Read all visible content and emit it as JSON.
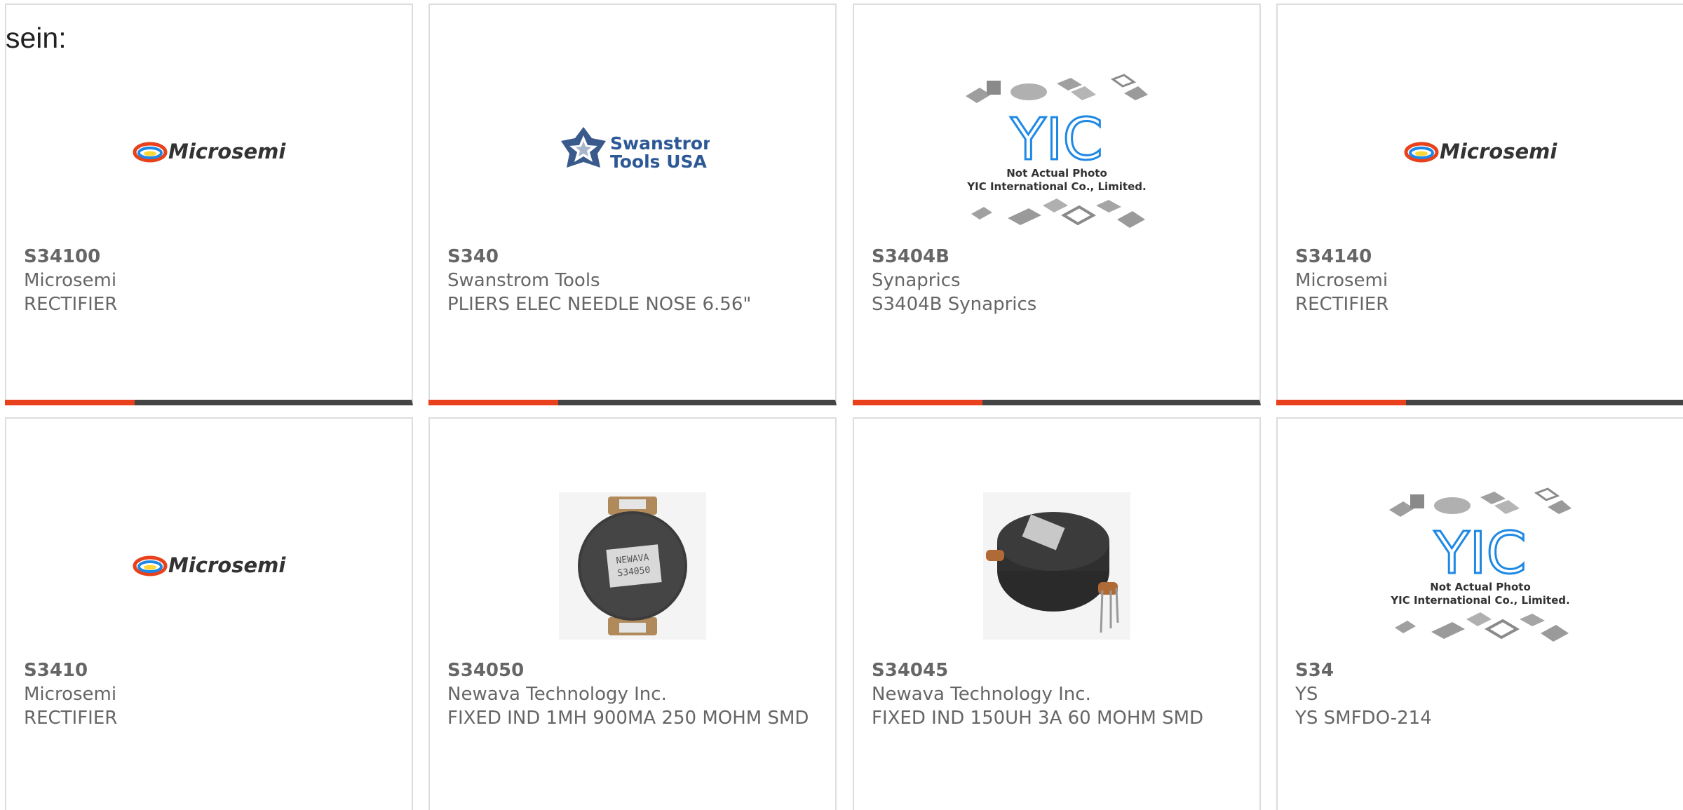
{
  "heading": "sein:",
  "colors": {
    "accent": "#e8411b",
    "bar": "#444444",
    "border": "#dddddd",
    "text": "#666666"
  },
  "products": [
    {
      "part": "S34100",
      "maker": "Microsemi",
      "desc": "RECTIFIER",
      "image": "microsemi-logo",
      "logo_text": "Microsemi"
    },
    {
      "part": "S340",
      "maker": "Swanstrom Tools",
      "desc": "PLIERS ELEC NEEDLE NOSE 6.56\"",
      "image": "swanstrom-logo",
      "logo_line1": "Swanstrom",
      "logo_line2": "Tools USA"
    },
    {
      "part": "S3404B",
      "maker": "Synaprics",
      "desc": "S3404B Synaprics",
      "image": "yic-placeholder",
      "logo_text": "YIC",
      "note1": "Not Actual Photo",
      "note2": "YIC International Co., Limited."
    },
    {
      "part": "S34140",
      "maker": "Microsemi",
      "desc": "RECTIFIER",
      "image": "microsemi-logo",
      "logo_text": "Microsemi"
    },
    {
      "part": "S3410",
      "maker": "Microsemi",
      "desc": "RECTIFIER",
      "image": "microsemi-logo",
      "logo_text": "Microsemi"
    },
    {
      "part": "S34050",
      "maker": "Newava Technology Inc.",
      "desc": "FIXED IND 1MH 900MA 250 MOHM SMD",
      "image": "inductor-top-photo",
      "label1": "NEWAVA",
      "label2": "S34050"
    },
    {
      "part": "S34045",
      "maker": "Newava Technology Inc.",
      "desc": "FIXED IND 150UH 3A 60 MOHM SMD",
      "image": "inductor-side-photo"
    },
    {
      "part": "S34",
      "maker": "YS",
      "desc": "YS SMFDO-214",
      "image": "yic-placeholder",
      "logo_text": "YIC",
      "note1": "Not Actual Photo",
      "note2": "YIC International Co., Limited."
    }
  ]
}
